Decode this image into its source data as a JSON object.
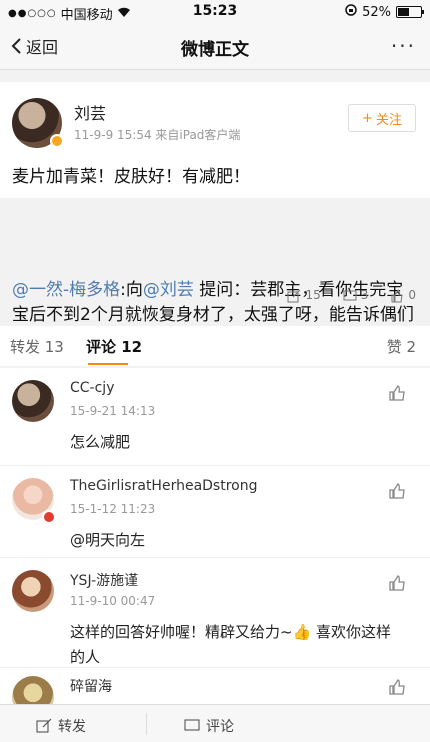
{
  "status_bar": {
    "carrier": "中国移动",
    "time": "15:23",
    "battery_percent": "52%",
    "battery_level": 0.52
  },
  "nav": {
    "back_label": "返回",
    "title": "微博正文",
    "more_label": "···"
  },
  "post": {
    "author": "刘芸",
    "meta": "11-9-9 15:54  来自iPad客户端",
    "follow_label": "关注",
    "text": "麦片加青菜！皮肤好！有减肥！",
    "repost": {
      "mention": "@一然-梅多格",
      "prefix_text": ":向",
      "mention2": "@刘芸",
      "body": " 提问：芸郡主，看你生完宝宝后不到2个月就恢复身材了，太强了呀，能告诉偶们秘诀吗?"
    },
    "stats": {
      "reposts": "15",
      "comments": "3",
      "likes": "0"
    }
  },
  "tabs": {
    "repost": "转发 13",
    "comment": "评论 12",
    "like": "赞 2"
  },
  "comments": [
    {
      "name": "CC-cjy",
      "date": "15-9-21 14:13",
      "body": "怎么减肥"
    },
    {
      "name": "TheGirlisratHerheaDstrong",
      "date": "15-1-12 11:23",
      "body": "@明天向左"
    },
    {
      "name": "YSJ-游施谨",
      "date": "11-9-10 00:47",
      "body": "这样的回答好帅喔！精辟又给力~👍 喜欢你这样的人"
    },
    {
      "name": "碎留海",
      "date": "",
      "body": ""
    }
  ],
  "toolbar": {
    "repost_label": "转发",
    "comment_label": "评论"
  },
  "colors": {
    "accent": "#f38b17",
    "link": "#4f7cad"
  }
}
